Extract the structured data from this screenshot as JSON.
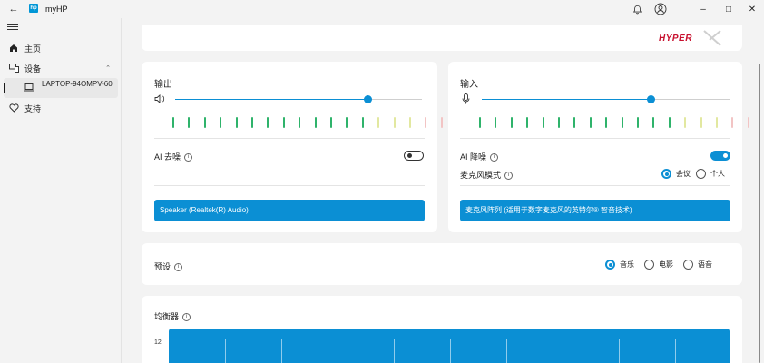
{
  "app": {
    "title": "myHP",
    "logo_text": "hp"
  },
  "window": {
    "minimize": "–",
    "maximize": "□",
    "close": "✕"
  },
  "sidebar": {
    "home": "主页",
    "devices": "设备",
    "device_name": "LAPTOP-94OMPV-60",
    "support": "支持"
  },
  "brand": {
    "name": "HYPERX"
  },
  "output": {
    "title": "输出",
    "volume_percent": 78,
    "ai_noise_label": "AI 去噪",
    "ai_noise_enabled": false,
    "device_selected": "Speaker (Realtek(R) Audio)"
  },
  "input": {
    "title": "输入",
    "volume_percent": 68,
    "ai_noise_label": "AI 降噪",
    "ai_noise_enabled": true,
    "mic_mode_label": "麦克风模式",
    "mic_mode_options": [
      "会议",
      "个人"
    ],
    "mic_mode_selected": "会议",
    "device_selected": "麦克风阵列 (适用于数字麦克风的英特尔® 智音技术)"
  },
  "preset": {
    "title": "预设",
    "options": [
      "音乐",
      "电影",
      "语音"
    ],
    "selected": "音乐"
  },
  "equalizer": {
    "title": "均衡器",
    "y_tick_top": "12"
  },
  "colors": {
    "accent": "#0b8fd4",
    "meter_green": "#2fb36b",
    "meter_yellow": "#e2e8a0",
    "meter_red": "#f2c4c4"
  }
}
